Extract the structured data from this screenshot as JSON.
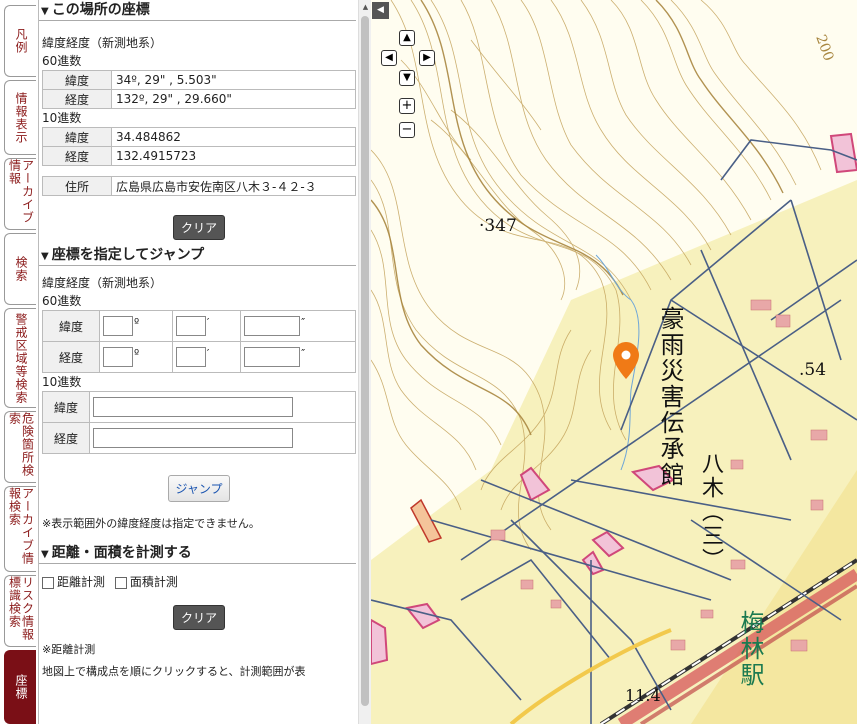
{
  "tabs": [
    {
      "label": "凡例",
      "active": false
    },
    {
      "label": "情報表示",
      "active": false
    },
    {
      "label": "アーカイブ情報",
      "active": false
    },
    {
      "label": "検索",
      "active": false
    },
    {
      "label": "警戒区域等検索",
      "active": false
    },
    {
      "label": "危険箇所検索",
      "active": false
    },
    {
      "label": "アーカイブ情報検索",
      "active": false
    },
    {
      "label": "リスク情報標識検索",
      "active": false
    },
    {
      "label": "座標",
      "active": true
    }
  ],
  "coords": {
    "title": "この場所の座標",
    "system": "緯度経度（新測地系）",
    "sixty": "60進数",
    "lat_label": "緯度",
    "lon_label": "経度",
    "lat60": "34º, 29\" , 5.503\"",
    "lon60": "132º, 29\" , 29.660\"",
    "ten": "10進数",
    "lat10": "34.484862",
    "lon10": "132.4915723",
    "addr_label": "住所",
    "addr": "広島県広島市安佐南区八木３-４２-３",
    "clear": "クリア"
  },
  "jump": {
    "title": "座標を指定してジャンプ",
    "system": "緯度経度（新測地系）",
    "sixty": "60進数",
    "lat_label": "緯度",
    "lon_label": "経度",
    "deg": "º",
    "min": "′",
    "sec": "″",
    "ten": "10進数",
    "button": "ジャンプ",
    "note": "※表示範囲外の緯度経度は指定できません。"
  },
  "measure": {
    "title": "距離・面積を計測する",
    "distance": "距離計測",
    "area": "面積計測",
    "clear": "クリア",
    "note1": "※距離計測",
    "note2": "地図上で構成点を順にクリックすると、計測範囲が表"
  },
  "map": {
    "label_347": "347",
    "label_54": ".54",
    "label_200": "200",
    "label_114": "11.4",
    "memorial": "豪雨災害伝承館",
    "yagi": "八木（三）",
    "station": "梅林駅"
  },
  "colors": {
    "accent": "#7a0f16",
    "marker": "#f07a16",
    "station": "#1b7a50"
  }
}
